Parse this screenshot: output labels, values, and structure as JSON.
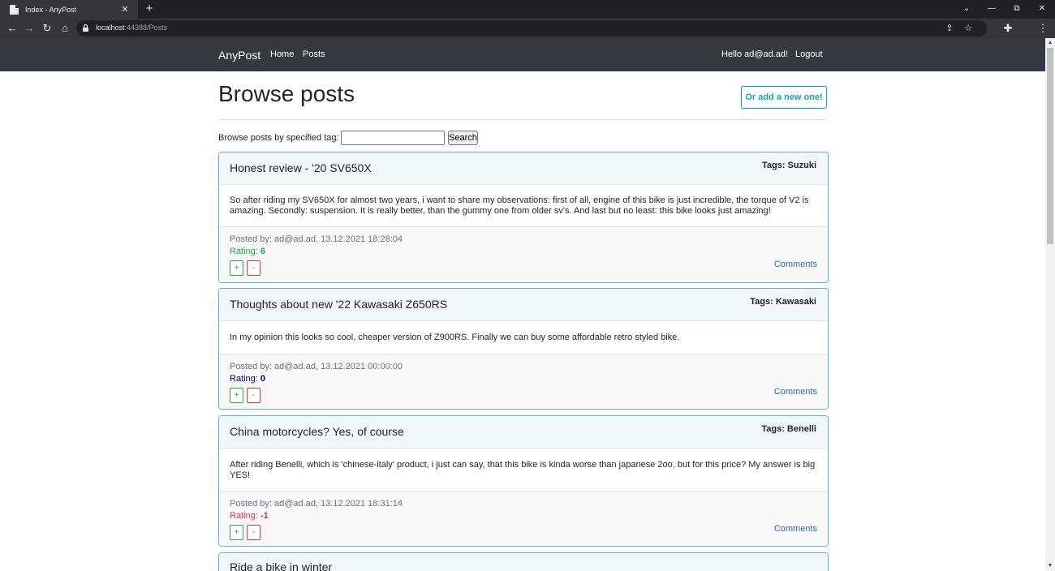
{
  "browser": {
    "tab_title": "Index - AnyPost",
    "tab_close": "✕",
    "new_tab": "+",
    "url_host": "localhost",
    "url_rest": ":44388/Posts",
    "controls": {
      "dropdown": "⌄",
      "minimize": "—",
      "restore": "⧉",
      "close": "✕"
    },
    "nav": {
      "back": "←",
      "forward": "→",
      "reload": "↻",
      "home": "⌂"
    },
    "icons": {
      "share": "⇪",
      "star": "☆",
      "extensions": "✚",
      "menu": "⋮"
    }
  },
  "site": {
    "brand": "AnyPost",
    "nav": {
      "home": "Home",
      "posts": "Posts"
    },
    "greeting": "Hello ad@ad.ad!",
    "logout": "Logout"
  },
  "page": {
    "title": "Browse posts",
    "add_button": "Or add a new one!",
    "search_label": "Browse posts by specified tag:",
    "search_value": "",
    "search_button": "Search"
  },
  "posts": [
    {
      "title": "Honest review - '20 SV650X",
      "tags": "Tags: Suzuki",
      "body": "So after riding my SV650X for almost two years, i want to share my observations: first of all, engine of this bike is just incredible, the torque of V2 is amazing. Secondly: suspension. It is really better, than the gummy one from older sv's. And last but no least: this bike looks just amazing!",
      "posted_by": "Posted by: ad@ad.ad, 13.12.2021 18:28:04",
      "rating_label": "Rating:",
      "rating_value": "6",
      "rating_color": "#28a745",
      "up": "+",
      "down": "-",
      "comments": "Comments"
    },
    {
      "title": "Thoughts about new '22 Kawasaki Z650RS",
      "tags": "Tags: Kawasaki",
      "body": "In my opinion this looks so cool, cheaper version of Z900RS. Finally we can buy some affordable retro styled bike.",
      "posted_by": "Posted by: ad@ad.ad, 13.12.2021 00:00:00",
      "rating_label": "Rating:",
      "rating_value": "0",
      "rating_color": "#00008b",
      "up": "+",
      "down": "-",
      "comments": "Comments"
    },
    {
      "title": "China motorcycles? Yes, of course",
      "tags": "Tags: Benelli",
      "body": "After riding Benelli, which is 'chinese-italy' product, i just can say, that this bike is kinda worse than japanese 2oo, but for this price? My answer is big YES!",
      "posted_by": "Posted by: ad@ad.ad, 13.12.2021 18:31:14",
      "rating_label": "Rating:",
      "rating_value": "-1",
      "rating_color": "#dc3545",
      "up": "+",
      "down": "-",
      "comments": "Comments"
    },
    {
      "title": "Ride a bike in winter"
    }
  ]
}
